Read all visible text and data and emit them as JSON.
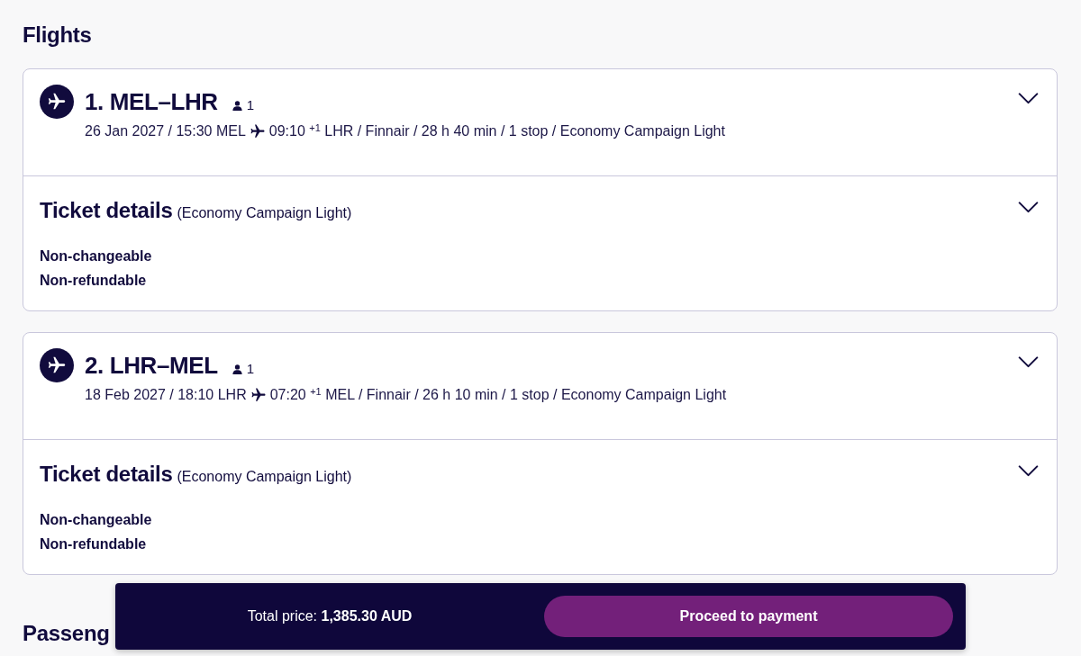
{
  "section_title": "Flights",
  "flights": [
    {
      "title": "1. MEL–LHR",
      "passengers": "1",
      "expanded": false,
      "departure": "26 Jan 2027 / 15:30 MEL",
      "arrival": "09:10 $^{+1}$ LHR / Finnair / 28 h 40 min / 1 stop / Economy Campaign Light",
      "ticket": {
        "title": "Ticket details",
        "fare": "(Economy Campaign Light)",
        "expanded": false,
        "conditions": [
          "Non-changeable",
          "Non-refundable"
        ]
      }
    },
    {
      "title": "2. LHR–MEL",
      "passengers": "1",
      "expanded": false,
      "departure": "18 Feb 2027 / 18:10 LHR",
      "arrival": "07:20 $^{+1}$ MEL / Finnair / 26 h 10 min / 1 stop / Economy Campaign Light",
      "ticket": {
        "title": "Ticket details",
        "fare": "(Economy Campaign Light)",
        "expanded": false,
        "conditions": [
          "Non-changeable",
          "Non-refundable"
        ]
      }
    }
  ],
  "next_section_title": "Passeng",
  "footer": {
    "total_price": "Total price: **1,385.30 AUD**",
    "button": "Proceed to payment"
  }
}
